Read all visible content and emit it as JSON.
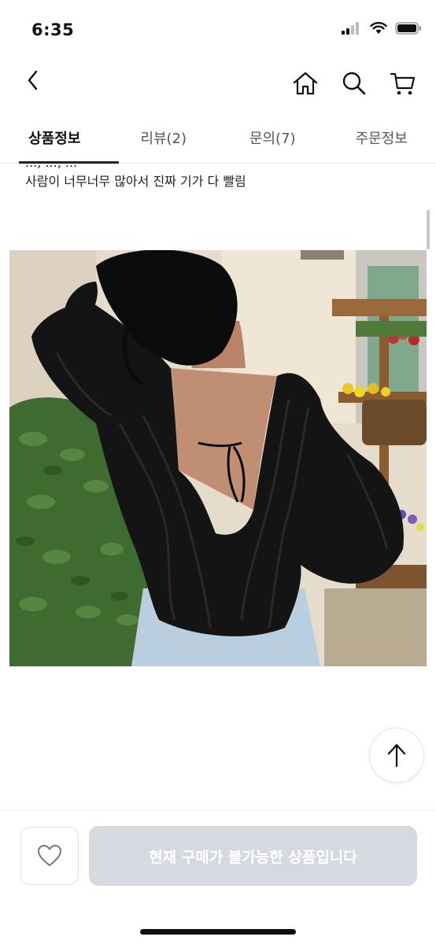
{
  "status_bar": {
    "time": "6:35"
  },
  "nav": {
    "back_icon": "chevron-left-icon",
    "home_icon": "home-icon",
    "search_icon": "search-icon",
    "cart_icon": "cart-icon"
  },
  "tabs": [
    {
      "label": "상품정보",
      "active": true
    },
    {
      "label": "리뷰(2)",
      "active": false
    },
    {
      "label": "문의(7)",
      "active": false
    },
    {
      "label": "주문정보",
      "active": false
    }
  ],
  "content": {
    "cut_text": "..., ..., ...",
    "description": "사람이 너무너무 많아서 진짜 기가 다 빨림"
  },
  "bottom_bar": {
    "like_icon": "heart-icon",
    "buy_label": "현재 구매가 불가능한 상품입니다"
  },
  "colors": {
    "accent": "#222222",
    "disabled_button": "#d6dae0",
    "blouse": "#151515"
  }
}
